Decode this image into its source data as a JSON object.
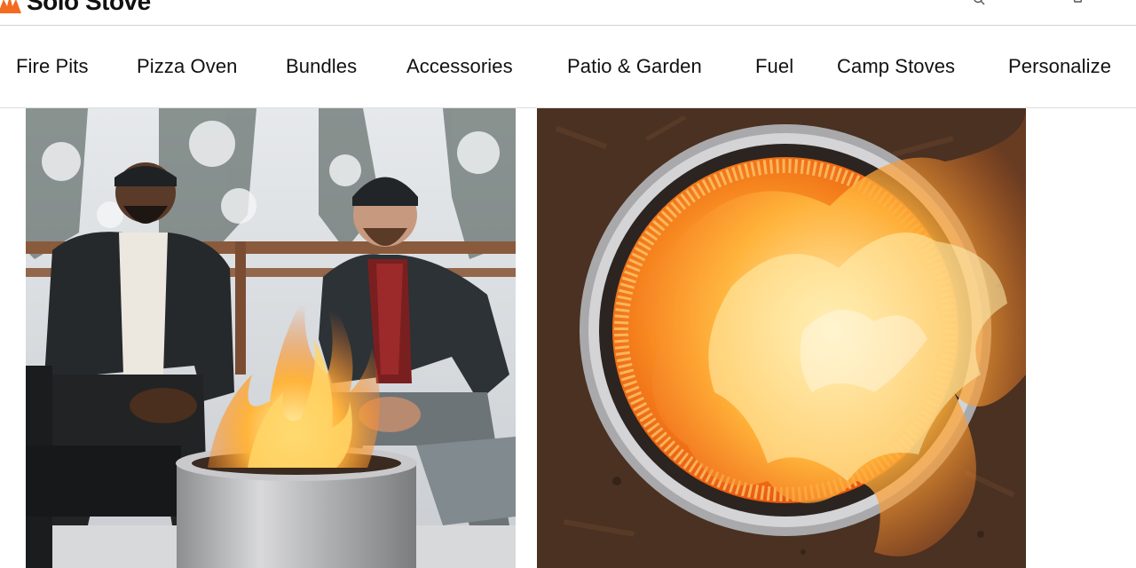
{
  "brand": {
    "name": "Solo Stove",
    "accent": "#f26b21"
  },
  "nav": {
    "items": [
      {
        "label": "Fire Pits"
      },
      {
        "label": "Pizza Oven"
      },
      {
        "label": "Bundles"
      },
      {
        "label": "Accessories"
      },
      {
        "label": "Patio & Garden"
      },
      {
        "label": "Fuel"
      },
      {
        "label": "Camp Stoves"
      },
      {
        "label": "Personalize"
      }
    ]
  },
  "header_icons": [
    "search-icon",
    "cart-icon"
  ],
  "hero_images": [
    {
      "icon": "photo-friends-around-fire-pit"
    },
    {
      "icon": "photo-fire-pit-flames-top-view"
    }
  ]
}
